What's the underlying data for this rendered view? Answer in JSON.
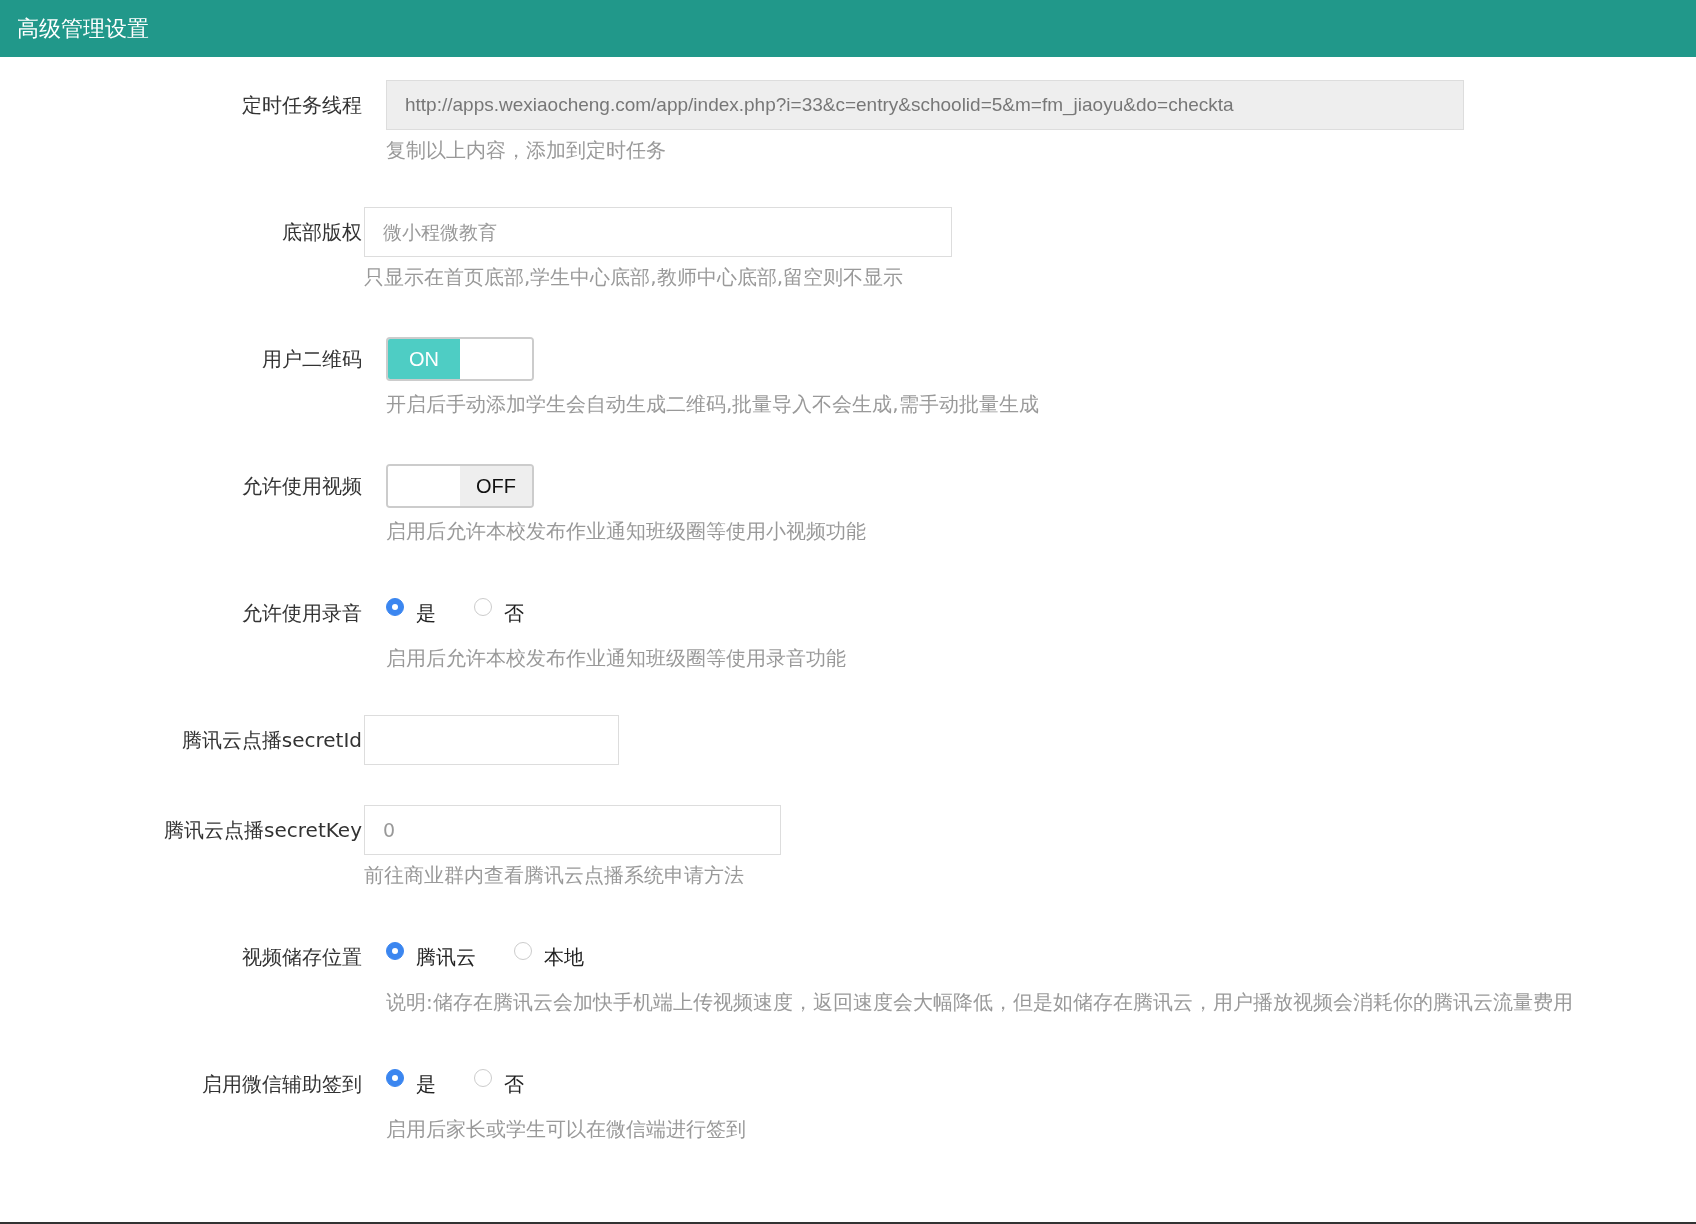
{
  "header": {
    "title": "高级管理设置"
  },
  "rows": [
    {
      "kind": "readonly",
      "label": "定时任务线程",
      "value": "http://apps.wexiaocheng.com/app/index.php?i=33&c=entry&schoolid=5&m=fm_jiaoyu&do=checkta",
      "hint": "复制以上内容，添加到定时任务"
    },
    {
      "kind": "text",
      "label": "底部版权",
      "placeholder": "微小程微教育",
      "hint": "只显示在首页底部,学生中心底部,教师中心底部,留空则不显示"
    },
    {
      "kind": "toggle",
      "label": "用户二维码",
      "on": true,
      "state_label": "ON",
      "hint": "开启后手动添加学生会自动生成二维码,批量导入不会生成,需手动批量生成"
    },
    {
      "kind": "toggle",
      "label": "允许使用视频",
      "on": false,
      "state_label": "OFF",
      "hint": "启用后允许本校发布作业通知班级圈等使用小视频功能"
    },
    {
      "kind": "radio",
      "label": "允许使用录音",
      "options": [
        {
          "label": "是",
          "selected": true
        },
        {
          "label": "否",
          "selected": false
        }
      ],
      "hint": "启用后允许本校发布作业通知班级圈等使用录音功能"
    },
    {
      "kind": "text",
      "label": "腾讯云点播secretId"
    },
    {
      "kind": "text",
      "label": "腾讯云点播secretKey",
      "placeholder": "0",
      "hint": "前往商业群内查看腾讯云点播系统申请方法"
    },
    {
      "kind": "radio",
      "label": "视频储存位置",
      "options": [
        {
          "label": "腾讯云",
          "selected": true
        },
        {
          "label": "本地",
          "selected": false
        }
      ],
      "hint": "说明:储存在腾讯云会加快手机端上传视频速度，返回速度会大幅降低，但是如储存在腾讯云，用户播放视频会消耗你的腾讯云流量费用"
    },
    {
      "kind": "radio",
      "label": "启用微信辅助签到",
      "options": [
        {
          "label": "是",
          "selected": true
        },
        {
          "label": "否",
          "selected": false
        }
      ],
      "hint": "启用后家长或学生可以在微信端进行签到"
    }
  ]
}
